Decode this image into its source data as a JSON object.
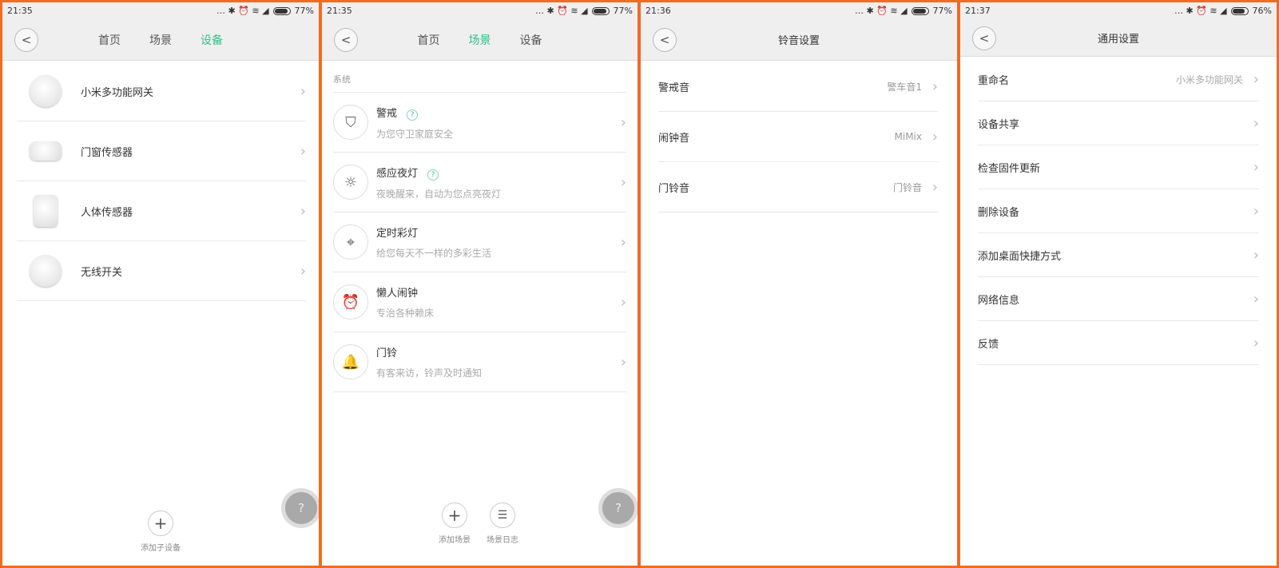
{
  "panels": [
    {
      "time": "21:35",
      "battery": "77%",
      "tabs": [
        "首页",
        "场景",
        "设备"
      ],
      "active_tab": 2,
      "devices": [
        "小米多功能网关",
        "门窗传感器",
        "人体传感器",
        "无线开关"
      ],
      "bottom": {
        "add_label": "添加子设备",
        "help": "?"
      }
    },
    {
      "time": "21:35",
      "battery": "77%",
      "tabs": [
        "首页",
        "场景",
        "设备"
      ],
      "active_tab": 1,
      "section": "系统",
      "scenes": [
        {
          "title": "警戒",
          "sub": "为您守卫家庭安全",
          "help": "?"
        },
        {
          "title": "感应夜灯",
          "sub": "夜晚醒来，自动为您点亮夜灯",
          "help": "?"
        },
        {
          "title": "定时彩灯",
          "sub": "给您每天不一样的多彩生活"
        },
        {
          "title": "懒人闹钟",
          "sub": "专治各种赖床"
        },
        {
          "title": "门铃",
          "sub": "有客来访，铃声及时通知"
        }
      ],
      "bottom": {
        "add_label": "添加场景",
        "log_label": "场景日志",
        "help": "?"
      }
    },
    {
      "time": "21:36",
      "battery": "77%",
      "title": "铃音设置",
      "items": [
        {
          "label": "警戒音",
          "value": "警车音1"
        },
        {
          "label": "闹钟音",
          "value": "MiMix"
        },
        {
          "label": "门铃音",
          "value": "门铃音"
        }
      ]
    },
    {
      "time": "21:37",
      "battery": "76%",
      "title": "通用设置",
      "items": [
        {
          "label": "重命名",
          "value": "小米多功能网关"
        },
        {
          "label": "设备共享"
        },
        {
          "label": "检查固件更新"
        },
        {
          "label": "删除设备"
        },
        {
          "label": "添加桌面快捷方式"
        },
        {
          "label": "网络信息"
        },
        {
          "label": "反馈"
        }
      ]
    }
  ]
}
